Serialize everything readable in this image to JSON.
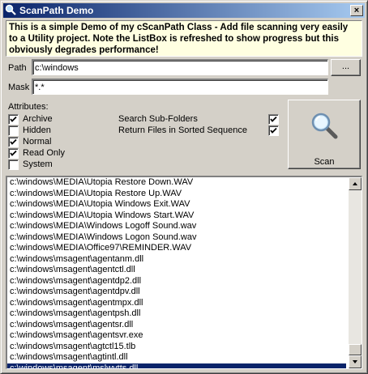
{
  "window": {
    "title": "ScanPath Demo",
    "close_label": "×"
  },
  "notice": "This is a simple Demo of my cScanPath Class - Add file scanning very easily to a Utility project. Note the ListBox is refreshed to show progress but this obviously degrades performance!",
  "path": {
    "label": "Path",
    "value": "c:\\windows",
    "browse_label": "..."
  },
  "mask": {
    "label": "Mask",
    "value": "*.*"
  },
  "attributes": {
    "label": "Attributes:",
    "items": [
      {
        "label": "Archive",
        "checked": true
      },
      {
        "label": "Hidden",
        "checked": false
      },
      {
        "label": "Normal",
        "checked": true
      },
      {
        "label": "Read Only",
        "checked": true
      },
      {
        "label": "System",
        "checked": false
      }
    ]
  },
  "options": [
    {
      "label": "Search Sub-Folders",
      "checked": true
    },
    {
      "label": "Return Files in Sorted Sequence",
      "checked": true
    }
  ],
  "scan_button": {
    "label": "Scan",
    "icon": "magnifier-icon"
  },
  "results": {
    "items": [
      "c:\\windows\\MEDIA\\Utopia Restore Down.WAV",
      "c:\\windows\\MEDIA\\Utopia Restore Up.WAV",
      "c:\\windows\\MEDIA\\Utopia Windows Exit.WAV",
      "c:\\windows\\MEDIA\\Utopia Windows Start.WAV",
      "c:\\windows\\MEDIA\\Windows Logoff Sound.wav",
      "c:\\windows\\MEDIA\\Windows Logon Sound.wav",
      "c:\\windows\\MEDIA\\Office97\\REMINDER.WAV",
      "c:\\windows\\msagent\\agentanm.dll",
      "c:\\windows\\msagent\\agentctl.dll",
      "c:\\windows\\msagent\\agentdp2.dll",
      "c:\\windows\\msagent\\agentdpv.dll",
      "c:\\windows\\msagent\\agentmpx.dll",
      "c:\\windows\\msagent\\agentpsh.dll",
      "c:\\windows\\msagent\\agentsr.dll",
      "c:\\windows\\msagent\\agentsvr.exe",
      "c:\\windows\\msagent\\agtctl15.tlb",
      "c:\\windows\\msagent\\agtintl.dll",
      "c:\\windows\\msagent\\mslwvtts.dll"
    ],
    "selected_index": 17
  },
  "colors": {
    "titlebar_start": "#0a246a",
    "titlebar_end": "#a6caf0",
    "notice_bg": "#ffffe1",
    "selection": "#0a246a"
  }
}
